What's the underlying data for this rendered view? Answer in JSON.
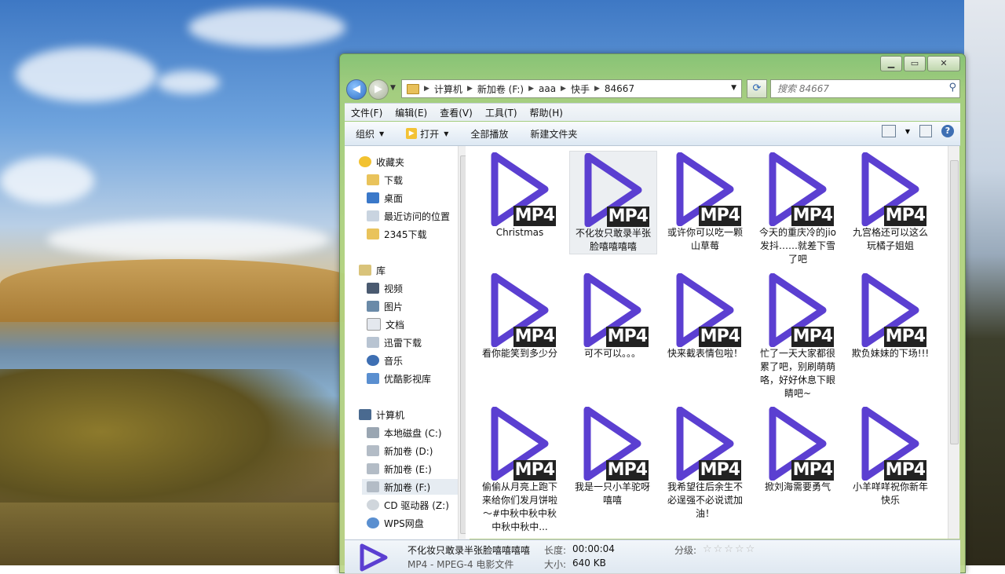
{
  "window": {
    "minimize": "▁",
    "maximize": "▭",
    "close": "✕"
  },
  "address": {
    "segments": [
      "计算机",
      "新加卷 (F:)",
      "aaa",
      "快手",
      "84667"
    ]
  },
  "search": {
    "placeholder": "搜索 84667"
  },
  "menu": [
    "文件(F)",
    "编辑(E)",
    "查看(V)",
    "工具(T)",
    "帮助(H)"
  ],
  "toolbar": {
    "organize": "组织",
    "open": "打开",
    "play_all": "全部播放",
    "new_folder": "新建文件夹",
    "help": "?"
  },
  "nav": {
    "favorites": "收藏夹",
    "downloads": "下载",
    "desktop": "桌面",
    "recent": "最近访问的位置",
    "dl2345": "2345下载",
    "libraries": "库",
    "videos": "视频",
    "pictures": "图片",
    "documents": "文档",
    "xunlei": "迅雷下载",
    "music": "音乐",
    "youku": "优酷影视库",
    "computer": "计算机",
    "drive_c": "本地磁盘 (C:)",
    "drive_d": "新加卷 (D:)",
    "drive_e": "新加卷 (E:)",
    "drive_f": "新加卷 (F:)",
    "drive_z": "CD 驱动器 (Z:)",
    "wps": "WPS网盘"
  },
  "badge": "MP4",
  "files": [
    {
      "name": "Christmas"
    },
    {
      "name": "不化妆只敢录半张脸嘻嘻嘻嘻"
    },
    {
      "name": "或许你可以吃一颗山草莓"
    },
    {
      "name": "今天的重庆冷的jio发抖……就差下雪了吧"
    },
    {
      "name": "九宫格还可以这么玩橘子姐姐"
    },
    {
      "name": "看你能笑到多少分"
    },
    {
      "name": "可不可以。。。"
    },
    {
      "name": "快来截表情包啦！"
    },
    {
      "name": "忙了一天大家都很累了吧，别刷萌萌咯，好好休息下眼睛吧~"
    },
    {
      "name": "欺负妹妹的下场!!!"
    },
    {
      "name": "偷偷从月亮上跑下来给你们发月饼啦～#中秋中秋中秋中秋中秋中..."
    },
    {
      "name": "我是一只小羊驼呀嘻嘻"
    },
    {
      "name": "我希望往后余生不必逞强不必说谎加油！"
    },
    {
      "name": "掀刘海需要勇气"
    },
    {
      "name": "小羊咩咩祝你新年快乐"
    }
  ],
  "details": {
    "name": "不化妆只敢录半张脸嘻嘻嘻嘻",
    "type": "MP4 - MPEG-4 电影文件",
    "length_label": "长度:",
    "length": "00:00:04",
    "size_label": "大小:",
    "size": "640 KB",
    "rating_label": "分级:",
    "stars": "☆☆☆☆☆"
  },
  "colors": {
    "play_icon": "#5b3fd1",
    "accent": "#3e6fb3"
  }
}
